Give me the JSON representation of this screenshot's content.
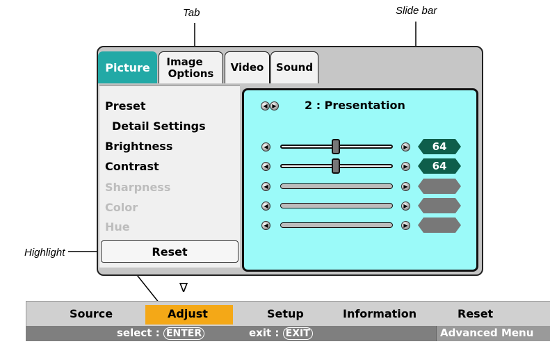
{
  "callouts": {
    "tab": "Tab",
    "slide_bar": "Slide bar",
    "highlight": "Highlight"
  },
  "tabs": [
    {
      "label": "Picture"
    },
    {
      "label_line1": "Image",
      "label_line2": "Options"
    },
    {
      "label": "Video"
    },
    {
      "label": "Sound"
    }
  ],
  "menu": {
    "items": [
      "Preset",
      "Detail Settings",
      "Brightness",
      "Contrast",
      "Sharpness",
      "Color",
      "Hue"
    ],
    "reset": "Reset"
  },
  "preset_value": "2 : Presentation",
  "sliders": [
    {
      "name": "Brightness",
      "value": "64",
      "level": 0.5,
      "enabled": true
    },
    {
      "name": "Contrast",
      "value": "64",
      "level": 0.5,
      "enabled": true
    },
    {
      "name": "Sharpness",
      "value": "",
      "enabled": false
    },
    {
      "name": "Color",
      "value": "",
      "enabled": false
    },
    {
      "name": "Hue",
      "value": "",
      "enabled": false
    }
  ],
  "bottom_menu": [
    "Source",
    "Adjust",
    "Setup",
    "Information",
    "Reset"
  ],
  "selected_menu": "Adjust",
  "status": {
    "select_label": "select :",
    "select_key": "ENTER",
    "exit_label": "exit :",
    "exit_key": "EXIT",
    "mode": "Advanced Menu"
  },
  "indicator": "∇",
  "colors": {
    "active_tab": "#22a9a6",
    "panel": "#9bfaf9",
    "highlight": "#f4a817",
    "badge": "#0e5e4b",
    "status_bar": "#7f7f7f"
  }
}
